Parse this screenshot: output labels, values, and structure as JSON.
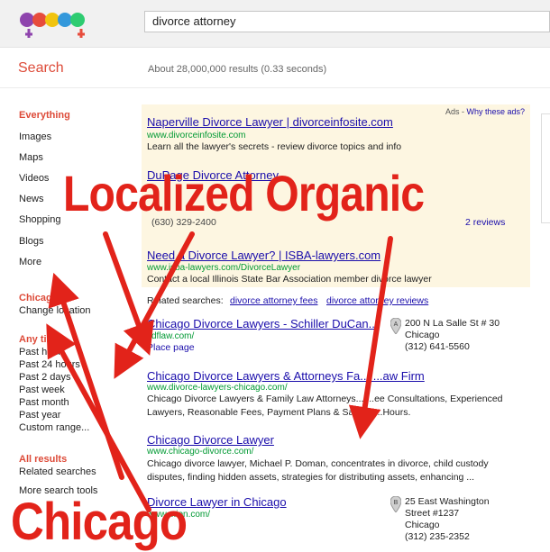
{
  "search": {
    "query": "divorce attorney",
    "title": "Search",
    "stats": "About 28,000,000 results (0.33 seconds)"
  },
  "nav": [
    "Everything",
    "Images",
    "Maps",
    "Videos",
    "News",
    "Shopping",
    "Blogs",
    "More"
  ],
  "location": {
    "name": "Chicago, IL",
    "change": "Change location"
  },
  "time": {
    "header": "Any time",
    "items": [
      "Past hour",
      "Past 24 hours",
      "Past 2 days",
      "Past week",
      "Past month",
      "Past year",
      "Custom range..."
    ]
  },
  "results_filter": {
    "header": "All results",
    "items": [
      "Related searches"
    ]
  },
  "more_tools": "More search tools",
  "ads": {
    "label": "Ads",
    "why": "Why these ads?",
    "items": [
      {
        "title": "Naperville Divorce Lawyer | divorceinfosite.com",
        "url": "www.divorceinfosite.com",
        "snippet": "Learn all the lawyer's secrets - review divorce topics and info"
      },
      {
        "title": "DuPage Divorce Attorney",
        "url": "",
        "snippet": "",
        "phone": "(630) 329-2400",
        "reviews": "2 reviews"
      },
      {
        "title": "Need a Divorce Lawyer? | ISBA-lawyers.com",
        "url": "www.isba-lawyers.com/DivorceLawyer",
        "snippet": "Contact a local Illinois State Bar Association member divorce lawyer"
      }
    ]
  },
  "related": {
    "label": "Related searches:",
    "links": [
      "divorce attorney fees",
      "divorce attorney reviews"
    ]
  },
  "results": [
    {
      "title": "Chicago Divorce Lawyers - Schiller DuCan...",
      "url": "sdflaw.com/",
      "place": "Place page",
      "pin": "A",
      "address": [
        "200 N La Salle St # 30",
        "Chicago",
        "(312) 641-5560"
      ]
    },
    {
      "title": "Chicago Divorce Lawyers & Attorneys Fa... ...aw Firm",
      "url": "www.divorce-lawyers-chicago.com/",
      "snippet": "Chicago Divorce Lawyers & Family Law Attorneys... ...ee Consultations, Experienced Lawyers, Reasonable Fees, Payment Plans & Satur... ...Hours."
    },
    {
      "title": "Chicago Divorce Lawyer",
      "url": "www.chicago-divorce.com/",
      "snippet": "Chicago divorce lawyer, Michael P. Doman, concentrates in divorce, child custody disputes, finding hidden assets, strategies for distributing assets, enhancing ..."
    },
    {
      "title": "Divorce Lawyer in Chicago",
      "url": "www....ion.com/",
      "pin": "B",
      "address": [
        "25 East Washington",
        "Street #1237",
        "Chicago",
        "(312) 235-2352"
      ]
    }
  ],
  "overlay": {
    "top": "Localized Organic",
    "bottom": "Chicago"
  },
  "colors": {
    "arrow": "#e2231a",
    "accent": "#dd4b39",
    "link": "#1a0dab",
    "url": "#009933",
    "ads_bg": "#fdf6e1"
  }
}
